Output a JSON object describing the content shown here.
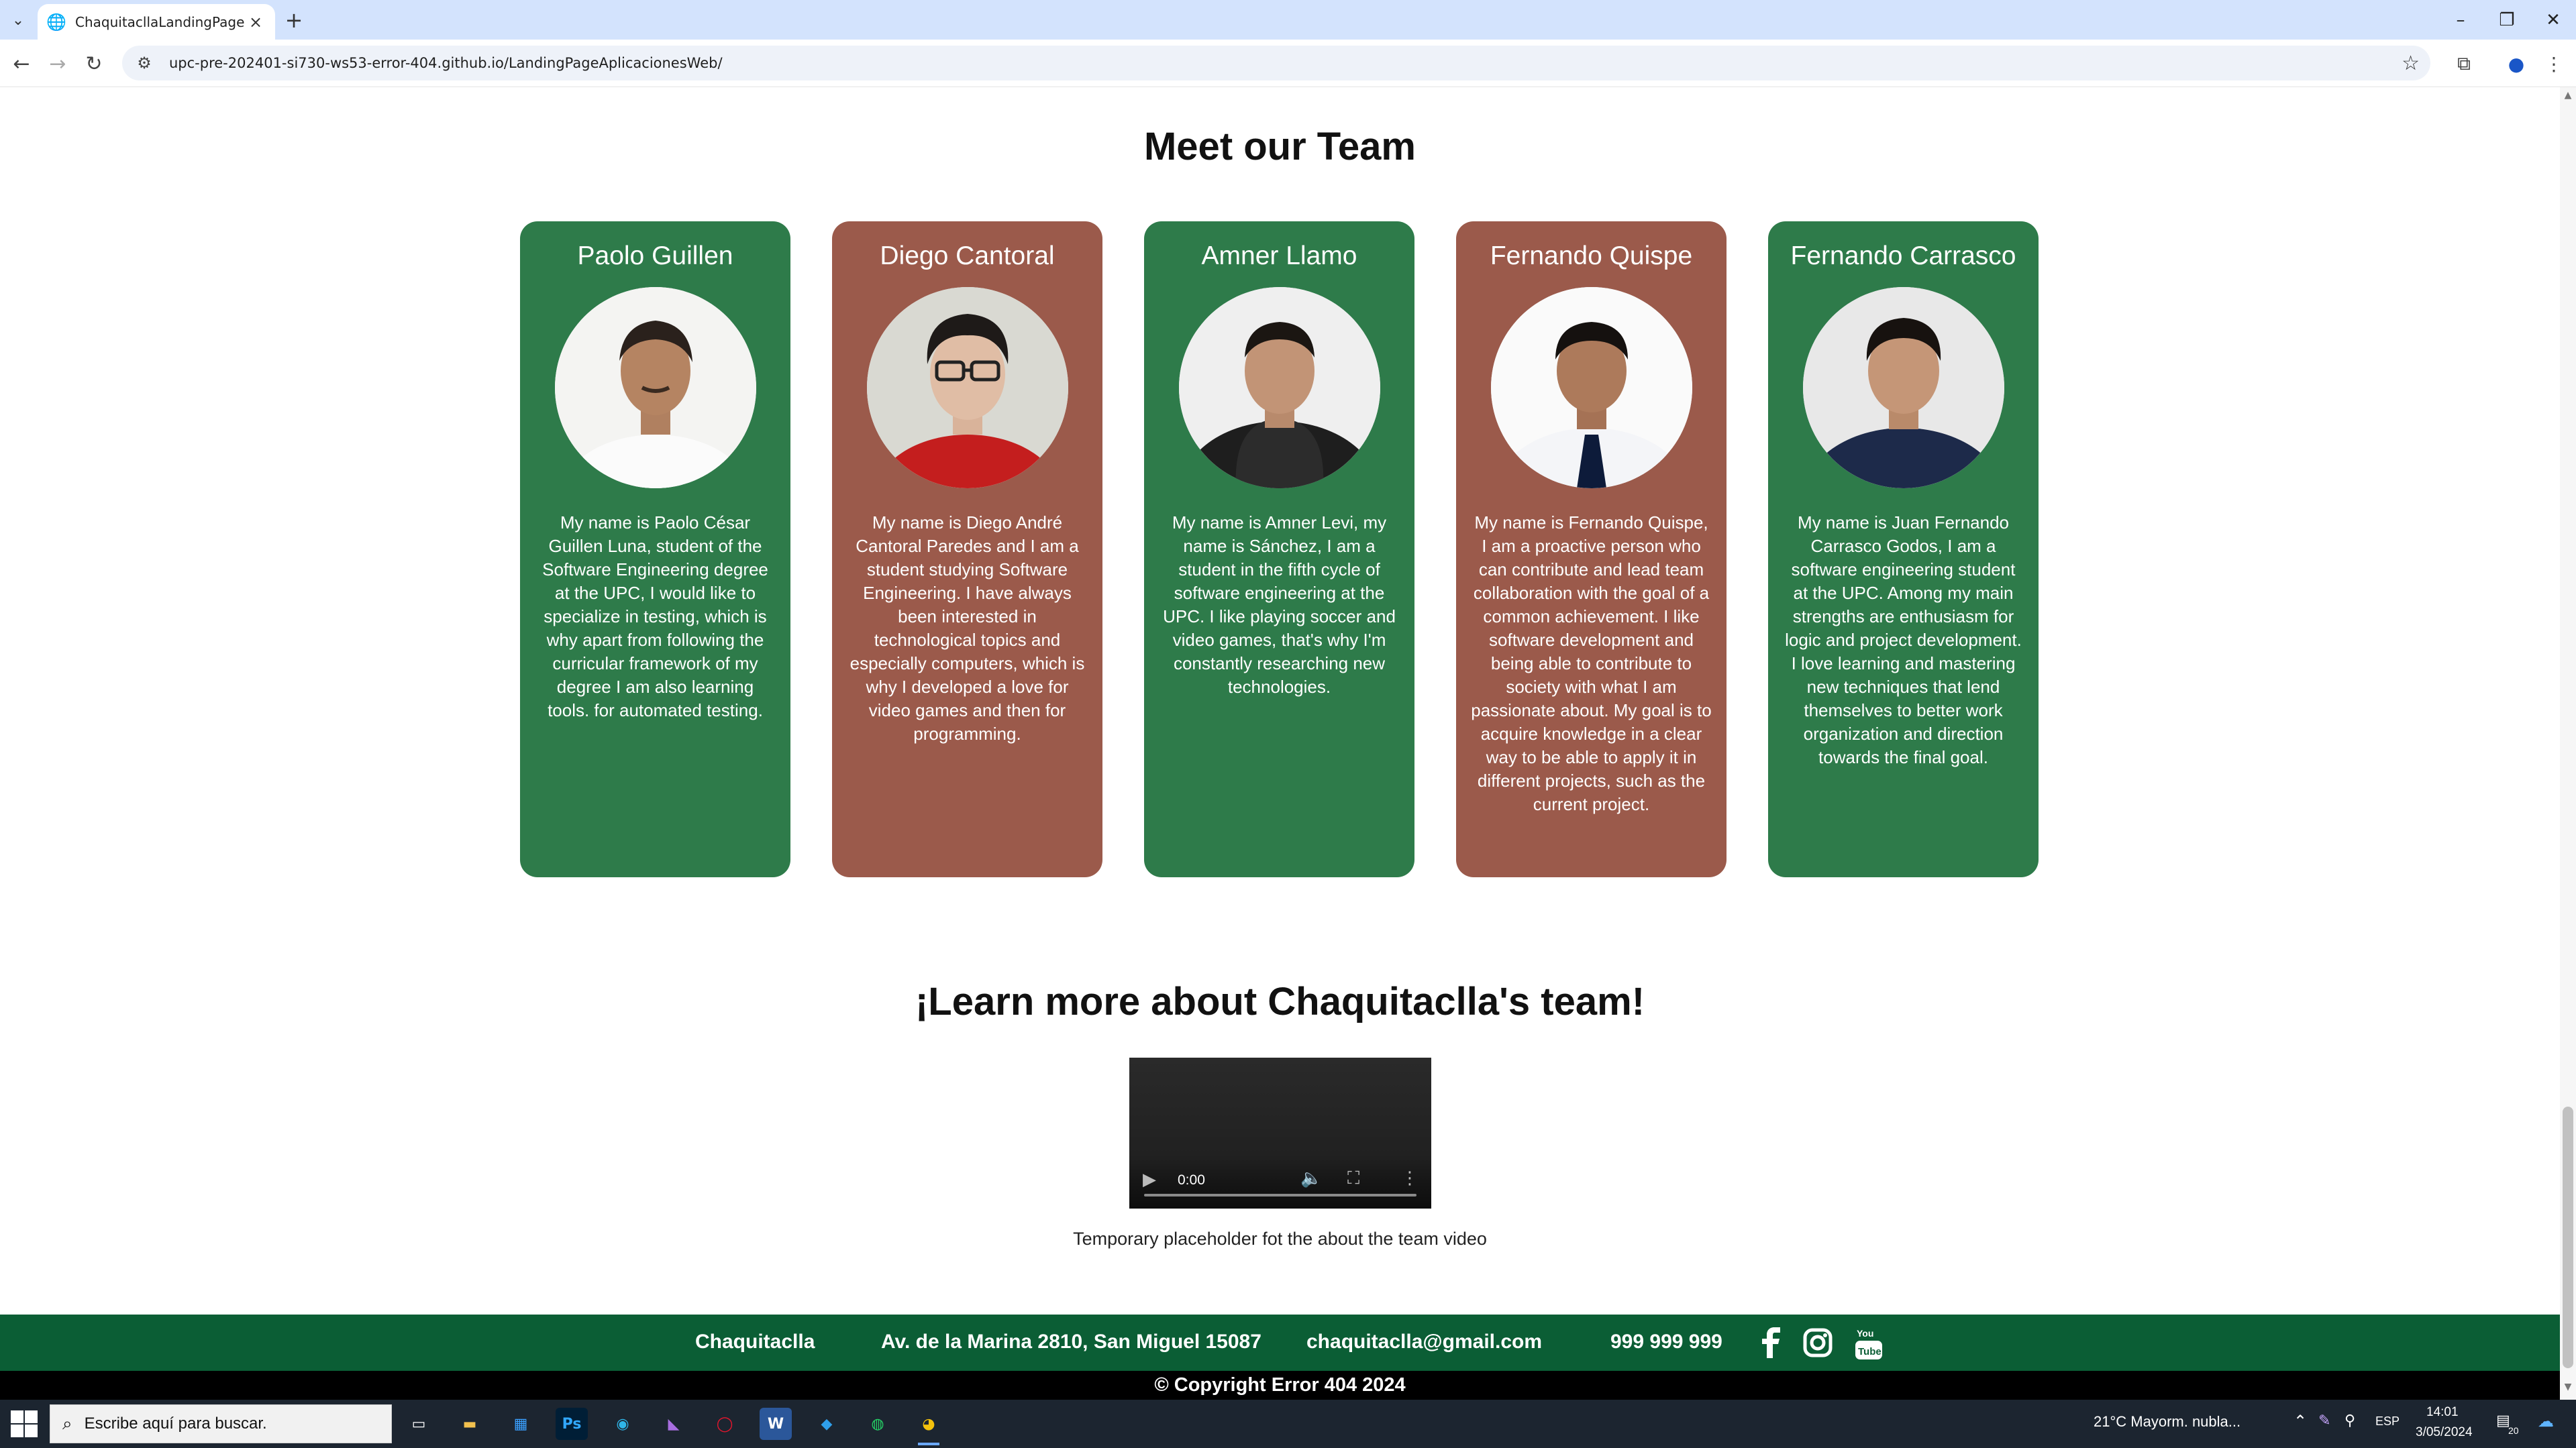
{
  "browser": {
    "tab_title": "ChaquitacllaLandingPage",
    "url": "upc-pre-202401-si730-ws53-error-404.github.io/LandingPageAplicacionesWeb/"
  },
  "team": {
    "title": "Meet our Team",
    "members": [
      {
        "name": "Paolo Guillen",
        "bio": "My name is Paolo César Guillen Luna, student of the Software Engineering degree at the UPC, I would like to specialize in testing, which is why apart from following the curricular framework of my degree I am also learning tools. for automated testing.",
        "color": "#2e7b4a"
      },
      {
        "name": "Diego Cantoral",
        "bio": "My name is Diego André Cantoral Paredes and I am a student studying Software Engineering. I have always been interested in technological topics and especially computers, which is why I developed a love for video games and then for programming.",
        "color": "#9b5a4b"
      },
      {
        "name": "Amner Llamo",
        "bio": "My name is Amner Levi, my name is Sánchez, I am a student in the fifth cycle of software engineering at the UPC. I like playing soccer and video games, that's why I'm constantly researching new technologies.",
        "color": "#2e7b4a"
      },
      {
        "name": "Fernando Quispe",
        "bio": "My name is Fernando Quispe, I am a proactive person who can contribute and lead team collaboration with the goal of a common achievement. I like software development and being able to contribute to society with what I am passionate about. My goal is to acquire knowledge in a clear way to be able to apply it in different projects, such as the current project.",
        "color": "#9b5a4b"
      },
      {
        "name": "Fernando Carrasco",
        "bio": "My name is Juan Fernando Carrasco Godos, I am a software engineering student at the UPC. Among my main strengths are enthusiasm for logic and project development. I love learning and mastering new techniques that lend themselves to better work organization and direction towards the final goal.",
        "color": "#2e7b4a"
      }
    ]
  },
  "video_section": {
    "title": "¡Learn more about Chaquitaclla's team!",
    "time": "0:00",
    "caption": "Temporary placeholder fot the about the team video"
  },
  "footer": {
    "brand": "Chaquitaclla",
    "address": "Av. de la Marina 2810, San Miguel 15087",
    "email": "chaquitaclla@gmail.com",
    "phone": "999 999 999",
    "copyright": "© Copyright Error 404 2024"
  },
  "taskbar": {
    "search_placeholder": "Escribe aquí para buscar.",
    "weather": "21°C  Mayorm. nubla...",
    "language": "ESP",
    "time": "14:01",
    "date": "3/05/2024",
    "notifications": "20"
  }
}
